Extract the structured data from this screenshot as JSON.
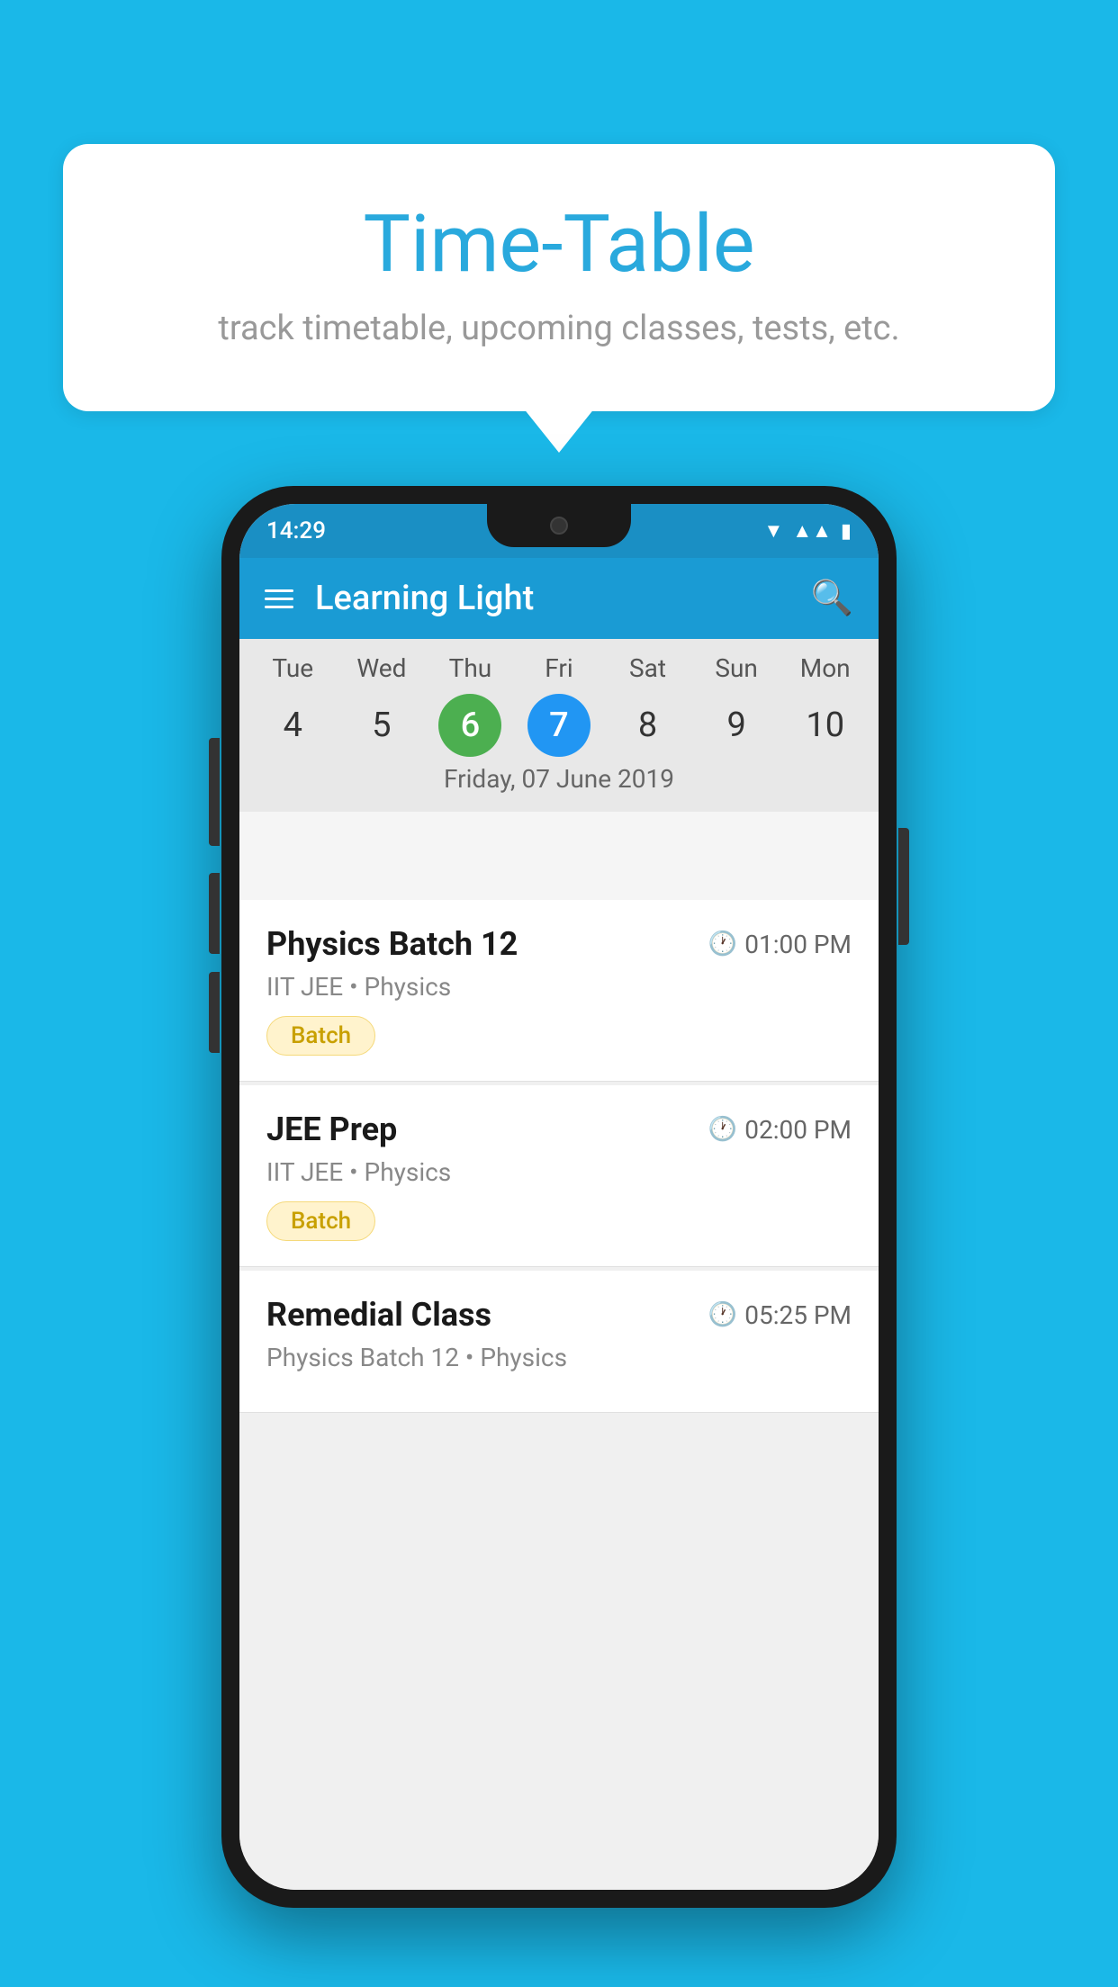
{
  "background": {
    "color": "#1ab8e8"
  },
  "speech_bubble": {
    "title": "Time-Table",
    "subtitle": "track timetable, upcoming classes, tests, etc."
  },
  "phone": {
    "status_bar": {
      "time": "14:29",
      "icons": [
        "wifi",
        "signal",
        "battery"
      ]
    },
    "app_bar": {
      "title": "Learning Light",
      "hamburger_label": "menu",
      "search_label": "search"
    },
    "calendar": {
      "days": [
        {
          "label": "Tue",
          "number": "4"
        },
        {
          "label": "Wed",
          "number": "5"
        },
        {
          "label": "Thu",
          "number": "6",
          "state": "today"
        },
        {
          "label": "Fri",
          "number": "7",
          "state": "selected"
        },
        {
          "label": "Sat",
          "number": "8"
        },
        {
          "label": "Sun",
          "number": "9"
        },
        {
          "label": "Mon",
          "number": "10"
        }
      ],
      "selected_date_label": "Friday, 07 June 2019"
    },
    "schedule": [
      {
        "title": "Physics Batch 12",
        "time": "01:00 PM",
        "subtitle": "IIT JEE • Physics",
        "badge": "Batch"
      },
      {
        "title": "JEE Prep",
        "time": "02:00 PM",
        "subtitle": "IIT JEE • Physics",
        "badge": "Batch"
      },
      {
        "title": "Remedial Class",
        "time": "05:25 PM",
        "subtitle": "Physics Batch 12 • Physics",
        "badge": null
      }
    ]
  }
}
